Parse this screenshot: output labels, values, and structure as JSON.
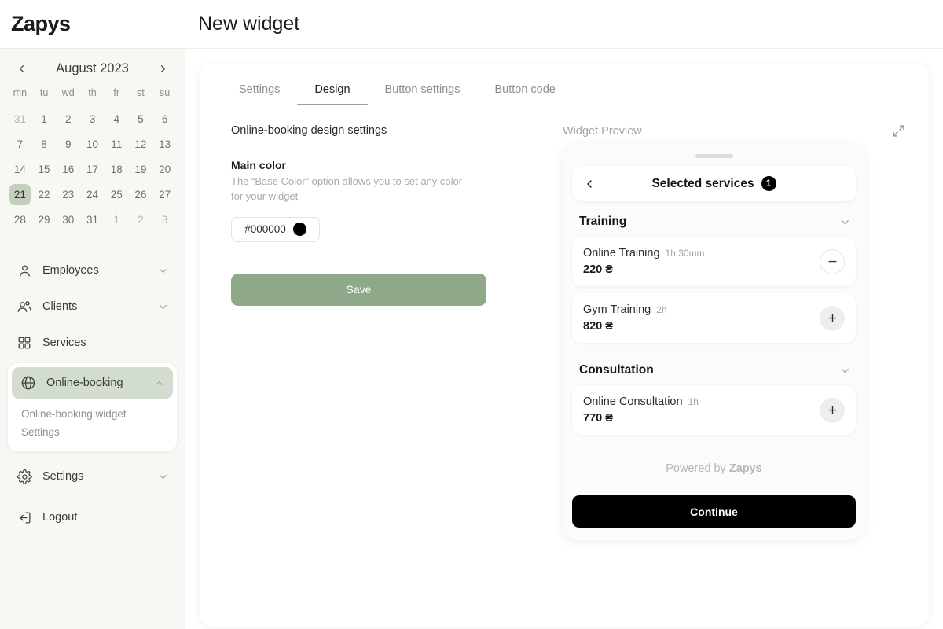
{
  "brand": {
    "name": "Zapys"
  },
  "calendar": {
    "month_label": "August 2023",
    "prev_icon": "chevron-left-icon",
    "next_icon": "chevron-right-icon",
    "weekdays": [
      "mn",
      "tu",
      "wd",
      "th",
      "fr",
      "st",
      "su"
    ],
    "weeks": [
      [
        {
          "d": "31",
          "muted": true
        },
        {
          "d": "1"
        },
        {
          "d": "2"
        },
        {
          "d": "3"
        },
        {
          "d": "4"
        },
        {
          "d": "5"
        },
        {
          "d": "6"
        }
      ],
      [
        {
          "d": "7"
        },
        {
          "d": "8"
        },
        {
          "d": "9"
        },
        {
          "d": "10"
        },
        {
          "d": "11"
        },
        {
          "d": "12"
        },
        {
          "d": "13"
        }
      ],
      [
        {
          "d": "14"
        },
        {
          "d": "15"
        },
        {
          "d": "16"
        },
        {
          "d": "17"
        },
        {
          "d": "18"
        },
        {
          "d": "19"
        },
        {
          "d": "20"
        }
      ],
      [
        {
          "d": "21",
          "active": true
        },
        {
          "d": "22"
        },
        {
          "d": "23"
        },
        {
          "d": "24"
        },
        {
          "d": "25"
        },
        {
          "d": "26"
        },
        {
          "d": "27"
        }
      ],
      [
        {
          "d": "28"
        },
        {
          "d": "29"
        },
        {
          "d": "30"
        },
        {
          "d": "31"
        },
        {
          "d": "1",
          "muted": true
        },
        {
          "d": "2",
          "muted": true
        },
        {
          "d": "3",
          "muted": true
        }
      ]
    ],
    "active_day_color": "#c2d0bd"
  },
  "sidebar": {
    "items": [
      {
        "label": "Employees",
        "icon": "user-icon",
        "chevron": "chevron-down-icon",
        "expandable": true
      },
      {
        "label": "Clients",
        "icon": "users-icon",
        "chevron": "chevron-down-icon",
        "expandable": true
      },
      {
        "label": "Services",
        "icon": "grid-icon",
        "expandable": false
      }
    ],
    "active_group": {
      "label": "Online-booking",
      "icon": "globe-icon",
      "chevron": "chevron-up-icon",
      "sub_items": [
        "Online-booking widget",
        "Settings"
      ],
      "highlight_color": "#d3ddcf"
    },
    "items_after": [
      {
        "label": "Settings",
        "icon": "gear-icon",
        "chevron": "chevron-down-icon",
        "expandable": true
      },
      {
        "label": "Logout",
        "icon": "logout-icon",
        "expandable": false
      }
    ]
  },
  "header": {
    "title": "New widget"
  },
  "tabs": [
    {
      "label": "Settings",
      "active": false
    },
    {
      "label": "Design",
      "active": true
    },
    {
      "label": "Button settings",
      "active": false
    },
    {
      "label": "Button code",
      "active": false
    }
  ],
  "design": {
    "section_title": "Online-booking design settings",
    "main_color_label": "Main color",
    "main_color_help": "The “Base Color” option allows you to set any color for your widget",
    "color_value": "#000000",
    "color_swatch": "#000000",
    "save_label": "Save",
    "save_color": "#8fa88a"
  },
  "preview": {
    "title": "Widget Preview",
    "expand_icon": "expand-icon",
    "widget": {
      "back_icon": "chevron-left-icon",
      "header_title": "Selected services",
      "badge_count": "1",
      "groups": [
        {
          "name": "Training",
          "chevron": "chevron-down-icon",
          "services": [
            {
              "name": "Online Training",
              "duration": "1h 30mm",
              "price": "220 ₴",
              "action": "remove",
              "action_icon": "minus-icon"
            },
            {
              "name": "Gym Training",
              "duration": "2h",
              "price": "820 ₴",
              "action": "add",
              "action_icon": "plus-icon"
            }
          ]
        },
        {
          "name": "Consultation",
          "chevron": "chevron-down-icon",
          "services": [
            {
              "name": "Online Consultation",
              "duration": "1h",
              "price": "770 ₴",
              "action": "add",
              "action_icon": "plus-icon"
            }
          ]
        }
      ],
      "powered_prefix": "Powered by ",
      "powered_brand": "Zapys",
      "continue_label": "Continue"
    }
  }
}
